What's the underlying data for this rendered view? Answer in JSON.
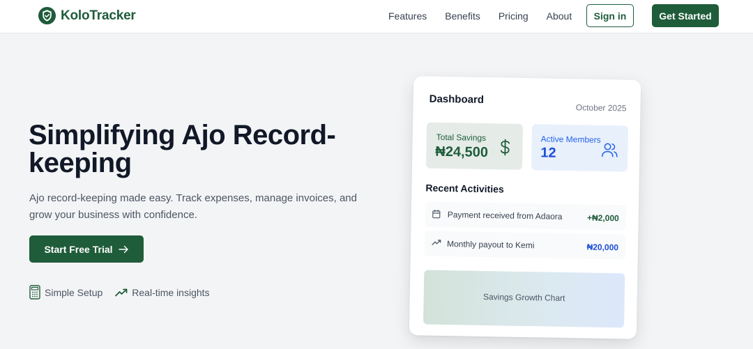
{
  "header": {
    "brand": "KoloTracker",
    "nav": [
      "Features",
      "Benefits",
      "Pricing",
      "About"
    ],
    "sign_in": "Sign in",
    "get_started": "Get Started"
  },
  "hero": {
    "title": "Simplifying Ajo Record-keeping",
    "subtitle": "Ajo record-keeping made easy. Track expenses, manage invoices, and grow your business with confidence.",
    "cta": "Start Free Trial",
    "features": [
      "Simple Setup",
      "Real-time insights"
    ]
  },
  "dashboard": {
    "title": "Dashboard",
    "date": "October 2025",
    "total_savings_label": "Total Savings",
    "total_savings_value": "₦24,500",
    "active_members_label": "Active Members",
    "active_members_value": "12",
    "recent_title": "Recent Activities",
    "activities": [
      {
        "label": "Payment received from Adaora",
        "amount": "+₦2,000",
        "icon": "calendar-icon"
      },
      {
        "label": "Monthly payout to Kemi",
        "amount": "₦20,000",
        "icon": "trending-up-icon"
      }
    ],
    "chart_placeholder": "Savings Growth Chart"
  },
  "colors": {
    "brand_green": "#1f5c3a",
    "accent_blue": "#1d4ed8",
    "page_bg": "#f3f4f6"
  }
}
